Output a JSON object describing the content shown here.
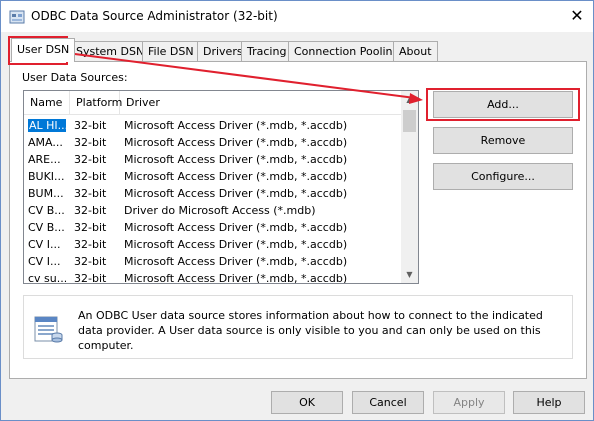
{
  "window": {
    "title": "ODBC Data Source Administrator (32-bit)",
    "close_symbol": "✕"
  },
  "tabs": [
    {
      "label": "User DSN",
      "active": true
    },
    {
      "label": "System DSN",
      "active": false
    },
    {
      "label": "File DSN",
      "active": false
    },
    {
      "label": "Drivers",
      "active": false
    },
    {
      "label": "Tracing",
      "active": false
    },
    {
      "label": "Connection Pooling",
      "active": false
    },
    {
      "label": "About",
      "active": false
    }
  ],
  "user_dsn": {
    "sources_label": "User Data Sources:",
    "columns": [
      "Name",
      "Platform",
      "Driver"
    ],
    "rows": [
      {
        "name": "AL HI...",
        "platform": "32-bit",
        "driver": "Microsoft Access Driver (*.mdb, *.accdb)",
        "selected": true
      },
      {
        "name": "AMA...",
        "platform": "32-bit",
        "driver": "Microsoft Access Driver (*.mdb, *.accdb)"
      },
      {
        "name": "ARE...",
        "platform": "32-bit",
        "driver": "Microsoft Access Driver (*.mdb, *.accdb)"
      },
      {
        "name": "BUKI...",
        "platform": "32-bit",
        "driver": "Microsoft Access Driver (*.mdb, *.accdb)"
      },
      {
        "name": "BUM...",
        "platform": "32-bit",
        "driver": "Microsoft Access Driver (*.mdb, *.accdb)"
      },
      {
        "name": "CV B...",
        "platform": "32-bit",
        "driver": "Driver do Microsoft Access (*.mdb)"
      },
      {
        "name": "CV B...",
        "platform": "32-bit",
        "driver": "Microsoft Access Driver (*.mdb, *.accdb)"
      },
      {
        "name": "CV I...",
        "platform": "32-bit",
        "driver": "Microsoft Access Driver (*.mdb, *.accdb)"
      },
      {
        "name": "CV I...",
        "platform": "32-bit",
        "driver": "Microsoft Access Driver (*.mdb, *.accdb)"
      },
      {
        "name": "cv su...",
        "platform": "32-bit",
        "driver": "Microsoft Access Driver (*.mdb, *.accdb)"
      }
    ],
    "buttons": {
      "add": "Add...",
      "remove": "Remove",
      "configure": "Configure..."
    },
    "info_text": "An ODBC User data source stores information about how to connect to the indicated data provider.   A User data source is only visible to you and can only be used on this computer."
  },
  "footer_buttons": {
    "ok": "OK",
    "cancel": "Cancel",
    "apply": "Apply",
    "help": "Help",
    "apply_enabled": false
  },
  "colors": {
    "annotation": "#e0202e",
    "selection": "#0078d7",
    "window_border": "#6a8fc8"
  }
}
